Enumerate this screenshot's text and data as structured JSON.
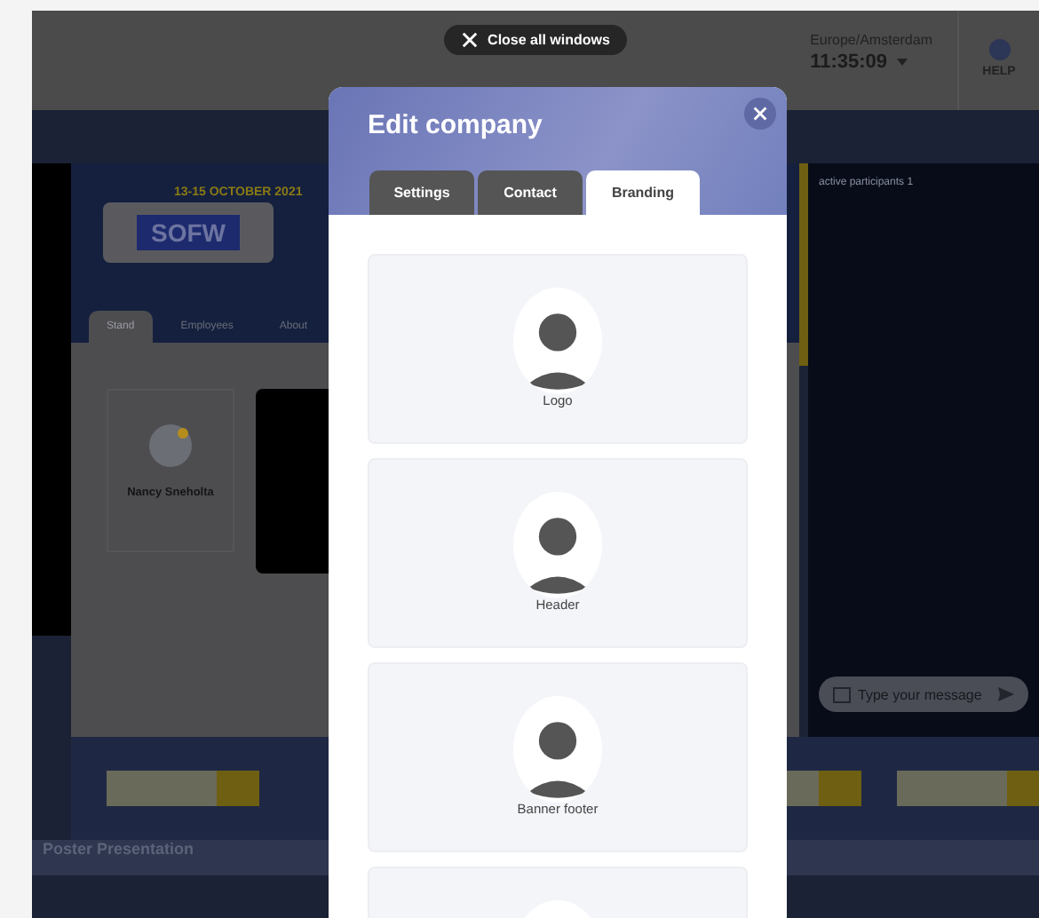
{
  "top_bar": {
    "close_all": "Close all windows",
    "timezone": "Europe/Amsterdam",
    "time": "11:35:09",
    "help": "HELP"
  },
  "stand": {
    "date": "13-15 OCTOBER 2021",
    "logo": "SOFW",
    "tabs": [
      {
        "label": "Stand",
        "selected": true
      },
      {
        "label": "Employees",
        "selected": false
      },
      {
        "label": "About",
        "selected": false
      }
    ],
    "employee": {
      "name": "Nancy Sneholta"
    }
  },
  "chat": {
    "participants": "active participants  1",
    "placeholder": "Type your message"
  },
  "section": {
    "title": "Poster Presentation"
  },
  "modal": {
    "title": "Edit company",
    "tabs": [
      {
        "label": "Settings",
        "selected": false
      },
      {
        "label": "Contact",
        "selected": false
      },
      {
        "label": "Branding",
        "selected": true
      }
    ],
    "uploads": [
      {
        "kind": "image",
        "label": "Logo"
      },
      {
        "kind": "image",
        "label": "Header"
      },
      {
        "kind": "image",
        "label": "Banner footer"
      },
      {
        "kind": "image"
      }
    ]
  }
}
